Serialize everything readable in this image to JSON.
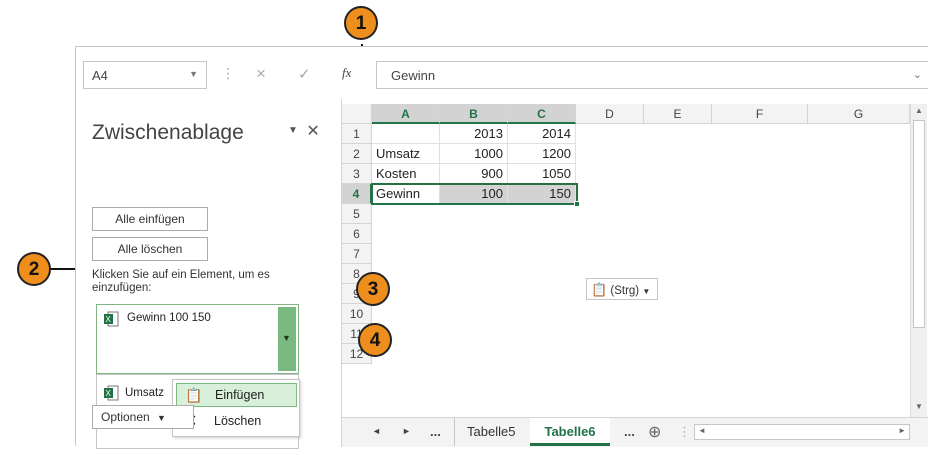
{
  "callouts": [
    "1",
    "2",
    "3",
    "4"
  ],
  "formula_bar": {
    "name_box": "A4",
    "cancel_symbol": "×",
    "enter_symbol": "✓",
    "fx_symbol": "fx",
    "value": "Gewinn"
  },
  "clipboard_pane": {
    "title": "Zwischenablage",
    "paste_all": "Alle einfügen",
    "clear_all": "Alle löschen",
    "hint": "Klicken Sie auf ein Element, um es einzufügen:",
    "items": [
      {
        "text": "Gewinn 100 150"
      },
      {
        "text": "Umsatz"
      }
    ],
    "options": "Optionen"
  },
  "context_menu": {
    "paste": "Einfügen",
    "delete": "Löschen"
  },
  "sheet": {
    "columns": [
      "A",
      "B",
      "C",
      "D",
      "E",
      "F",
      "G"
    ],
    "rows": [
      "1",
      "2",
      "3",
      "4",
      "5",
      "6",
      "7",
      "8",
      "9",
      "10",
      "11",
      "12"
    ],
    "cells": {
      "B1": "2013",
      "C1": "2014",
      "A2": "Umsatz",
      "B2": "1000",
      "C2": "1200",
      "A3": "Kosten",
      "B3": "900",
      "C3": "1050",
      "A4": "Gewinn",
      "B4": "100",
      "C4": "150"
    },
    "paste_options": "(Strg)"
  },
  "tabs": {
    "prev": "◄",
    "next": "►",
    "more_left": "...",
    "sheet_a": "Tabelle5",
    "sheet_b": "Tabelle6",
    "more_right": "...",
    "add": "⊕"
  },
  "colors": {
    "accent": "#217346",
    "callout": "#ee8e1c",
    "highlight": "#7ab980"
  }
}
